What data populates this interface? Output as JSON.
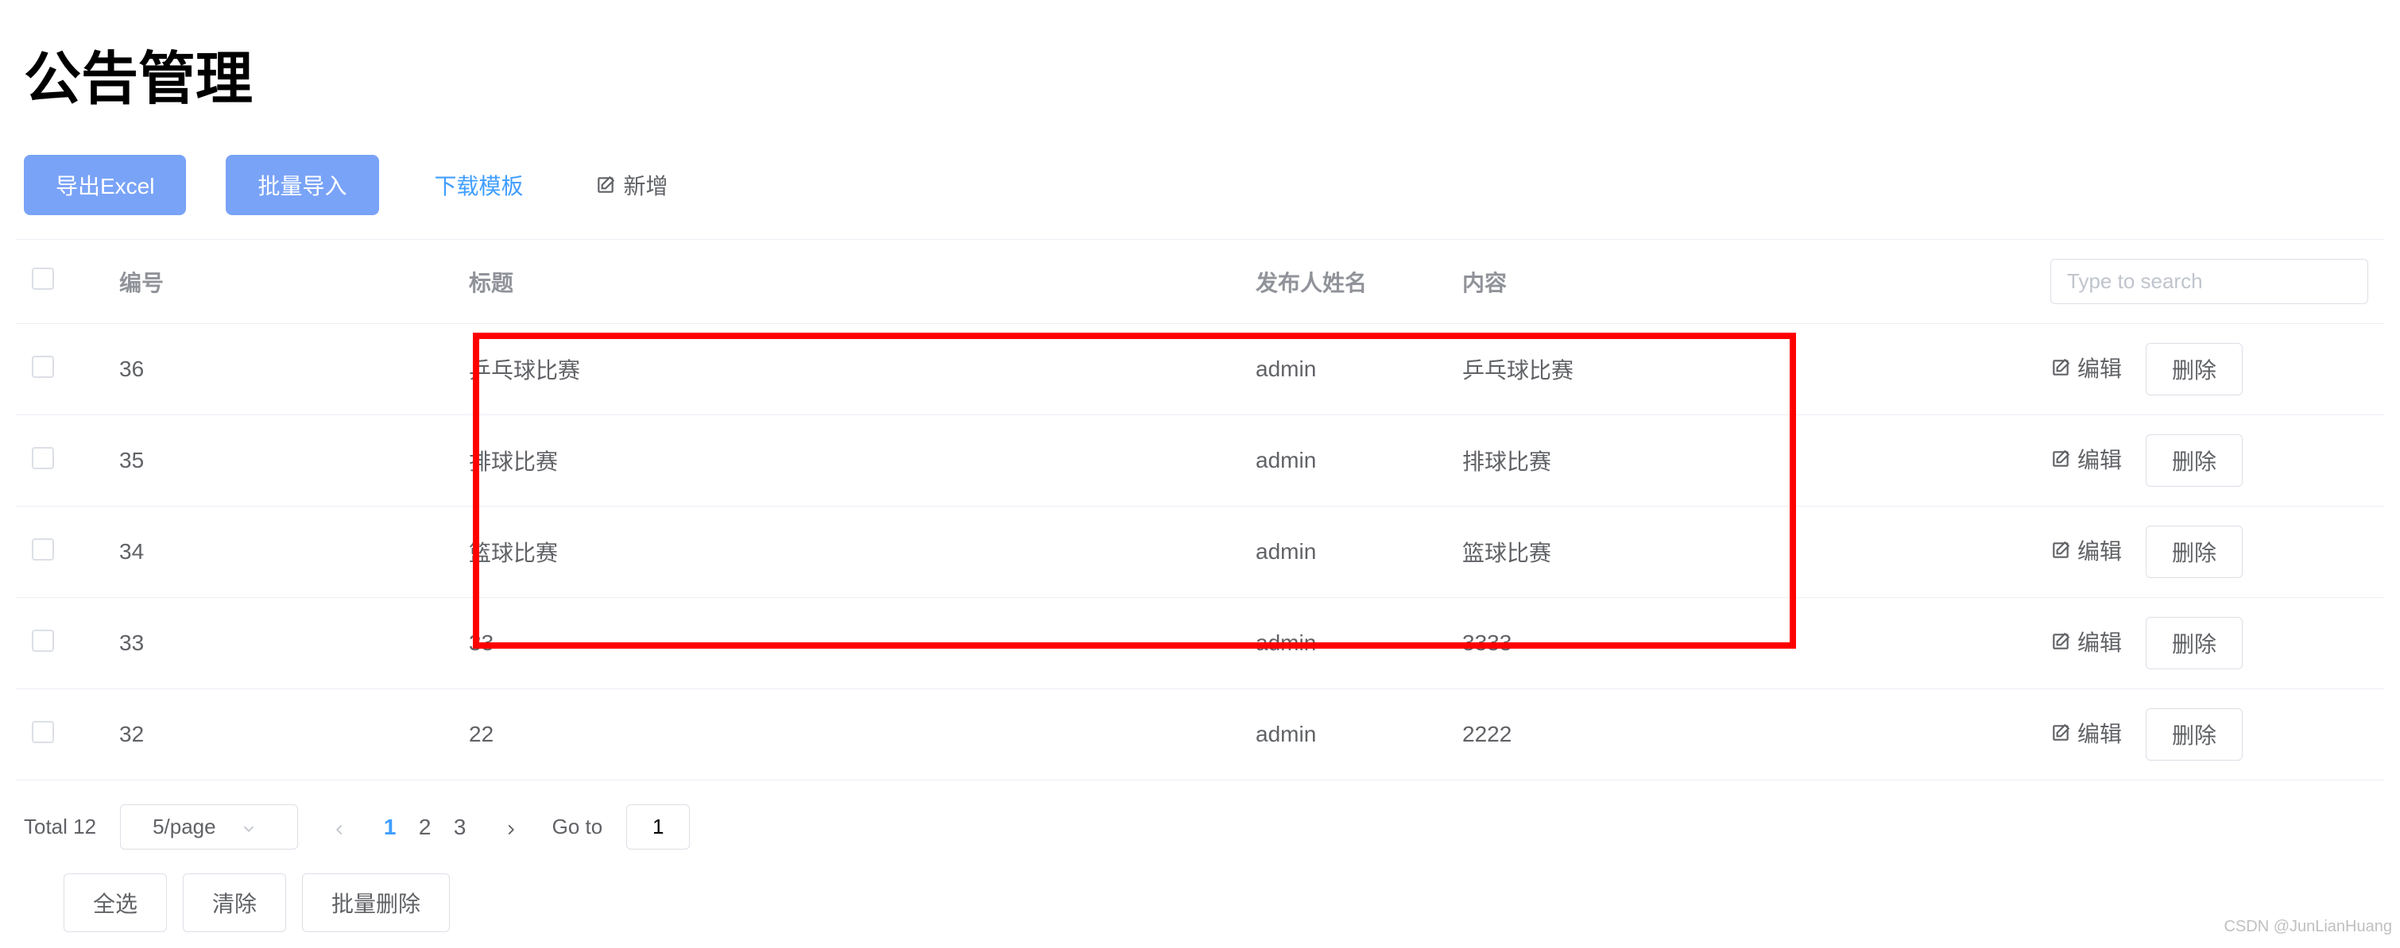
{
  "page_title": "公告管理",
  "toolbar": {
    "export_label": "导出Excel",
    "import_label": "批量导入",
    "template_label": "下载模板",
    "add_label": "新增"
  },
  "search": {
    "placeholder": "Type to search"
  },
  "columns": {
    "id": "编号",
    "title": "标题",
    "publisher": "发布人姓名",
    "content": "内容"
  },
  "actions": {
    "edit": "编辑",
    "delete": "删除"
  },
  "rows": [
    {
      "id": "36",
      "title": "乒乓球比赛",
      "publisher": "admin",
      "content": "乒乓球比赛"
    },
    {
      "id": "35",
      "title": "排球比赛",
      "publisher": "admin",
      "content": "排球比赛"
    },
    {
      "id": "34",
      "title": "篮球比赛",
      "publisher": "admin",
      "content": "篮球比赛"
    },
    {
      "id": "33",
      "title": "33",
      "publisher": "admin",
      "content": "3333"
    },
    {
      "id": "32",
      "title": "22",
      "publisher": "admin",
      "content": "2222"
    }
  ],
  "pagination": {
    "total_label": "Total 12",
    "page_size_label": "5/page",
    "pages": [
      "1",
      "2",
      "3"
    ],
    "active_page": "1",
    "goto_label": "Go to",
    "goto_value": "1"
  },
  "bulk": {
    "select_all": "全选",
    "clear": "清除",
    "batch_delete": "批量删除"
  },
  "watermark": "CSDN @JunLianHuang"
}
